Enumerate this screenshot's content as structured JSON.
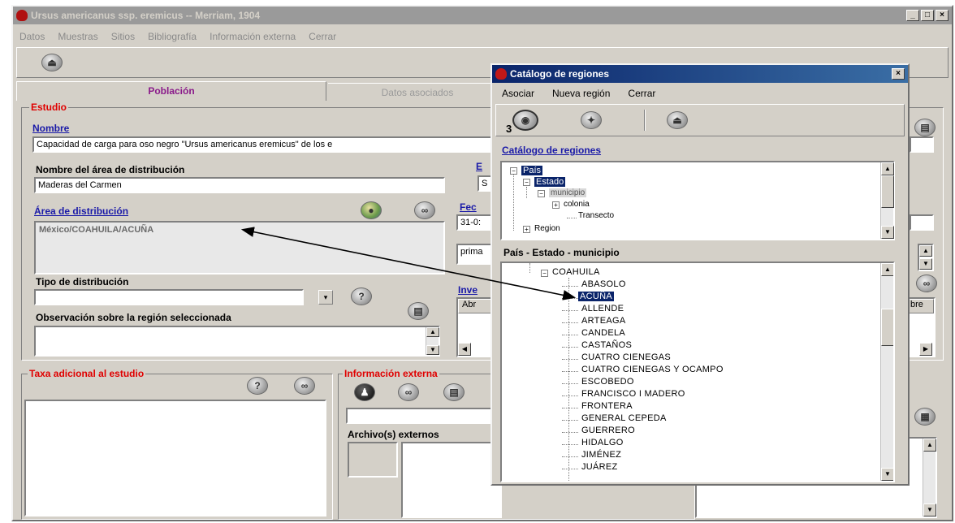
{
  "main_window": {
    "title": "Ursus americanus ssp. eremicus -- Merriam, 1904",
    "controls": [
      "_",
      "□",
      "×"
    ],
    "menu": [
      "Datos",
      "Muestras",
      "Sitios",
      "Bibliografía",
      "Información externa",
      "Cerrar"
    ],
    "tabs": [
      "Población",
      "Datos asociados"
    ],
    "estudio": {
      "group_title": "Estudio",
      "nombre_label": "Nombre",
      "nombre_value": "Capacidad de carga para oso negro \"Ursus americanus eremicus\" de los e",
      "area_nombre_label": "Nombre del área de distribución",
      "area_nombre_value": "Maderas del Carmen",
      "area_label": "Área de distribución",
      "area_value": "México/COAHUILA/ACUÑA",
      "tipo_label": "Tipo de distribución",
      "tipo_value": "",
      "obs_label": "Observación sobre la región seleccionada",
      "obs_value": "",
      "partial_e_label": "E",
      "partial_s_value": "S",
      "partial_fecha_label": "Fec",
      "partial_fecha_value": "31-0:",
      "partial_prima_value": "prima",
      "partial_inv_label": "Inve",
      "partial_abr_header": "Abr",
      "partial_bre_header": "bre"
    },
    "taxa": {
      "group_title": "Taxa adicional al estudio"
    },
    "info_externa": {
      "group_title": "Información externa",
      "archivos_label": "Archivo(s) externos"
    }
  },
  "catalog_window": {
    "title": "Catálogo de regiones",
    "close": "×",
    "menu": [
      "Asociar",
      "Nueva región",
      "Cerrar"
    ],
    "toolbar_badge": "3",
    "section_title": "Catálogo de regiones",
    "tree": [
      {
        "label": "País",
        "selected": true
      },
      {
        "label": "Estado",
        "selected": true
      },
      {
        "label": "municipio",
        "selected": false
      },
      {
        "label": "colonia",
        "selected": false
      },
      {
        "label": "Transecto",
        "selected": false
      },
      {
        "label": "Region",
        "selected": false
      }
    ],
    "list_header": "País - Estado - municipio",
    "state": "COAHUILA",
    "municipios": [
      "ABASOLO",
      "ACUÑA",
      "ALLENDE",
      "ARTEAGA",
      "CANDELA",
      "CASTAÑOS",
      "CUATRO CIENEGAS",
      "CUATRO CIENEGAS Y OCAMPO",
      "ESCOBEDO",
      "FRANCISCO I MADERO",
      "FRONTERA",
      "GENERAL CEPEDA",
      "GUERRERO",
      "HIDALGO",
      "JIMÉNEZ",
      "JUÁREZ"
    ],
    "selected_municipio": "ACUÑA"
  }
}
